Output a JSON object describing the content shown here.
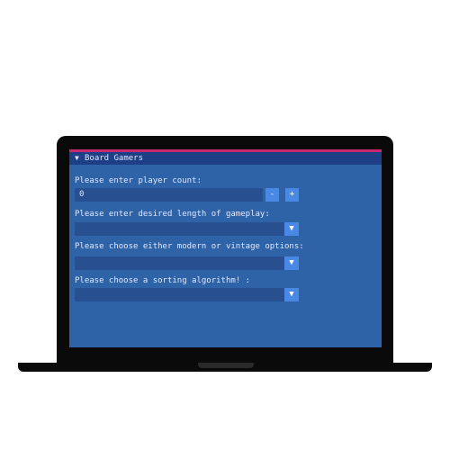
{
  "window": {
    "title": "Board Gamers",
    "collapse_icon": "triangle-down-icon",
    "accent_color": "#c8286e"
  },
  "player_count": {
    "label": "Please enter player count:",
    "value": "0",
    "minus": "-",
    "plus": "+"
  },
  "gameplay_length": {
    "label": "Please enter desired length of gameplay:",
    "value": "",
    "dropdown_icon": "chevron-down-icon"
  },
  "era_options": {
    "label": "Please choose either modern or vintage options:",
    "value": "",
    "dropdown_icon": "chevron-down-icon"
  },
  "sorting_algorithm": {
    "label": "Please choose a sorting algorithm! :",
    "value": "",
    "dropdown_icon": "chevron-down-icon"
  },
  "glyphs": {
    "triangle": "▼",
    "arrow": "▼"
  }
}
